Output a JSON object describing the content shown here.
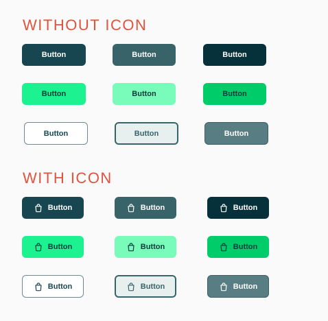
{
  "sections": {
    "without_icon_title": "WITHOUT ICON",
    "with_icon_title": "WITH ICON"
  },
  "button_label": "Button",
  "icon_name": "shopping-bag-icon",
  "colors": {
    "title": "#e0533e",
    "primary_dark": "#174650",
    "primary_dark_hover": "#386469",
    "primary_dark_pressed": "#06303a",
    "accent_green": "#1cf28f",
    "accent_green_hover": "#79fbba",
    "accent_green_pressed": "#00cc6a",
    "outline_default_bg": "#ffffff",
    "outline_focus_bg": "#e7efef",
    "outline_disabled_bg": "#587d82"
  }
}
